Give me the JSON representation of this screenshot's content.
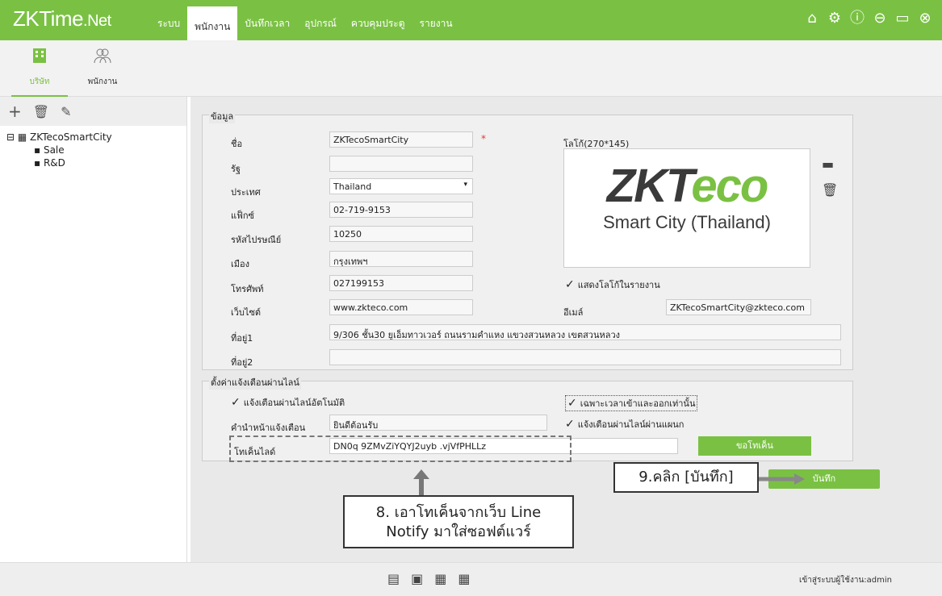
{
  "app": {
    "logo_main": "ZKTime",
    "logo_suffix": ".Net"
  },
  "menu": [
    "ระบบ",
    "พนักงาน",
    "บันทึกเวลา",
    "อุปกรณ์",
    "ควบคุมประตู",
    "รายงาน"
  ],
  "subtabs": [
    "บริษัท",
    "พนักงาน"
  ],
  "tree": {
    "root": "ZKTecoSmartCity",
    "children": [
      "Sale",
      "R&D"
    ]
  },
  "info": {
    "section": "ข้อมูล",
    "name_label": "ชื่อ",
    "name": "ZKTecoSmartCity",
    "required": "*",
    "state_label": "รัฐ",
    "state": "",
    "country_label": "ประเทศ",
    "country": "Thailand",
    "fax_label": "แฟ็กซ์",
    "fax": "02-719-9153",
    "zip_label": "รหัสไปรษณีย์",
    "zip": "10250",
    "city_label": "เมือง",
    "city": "กรุงเทพฯ",
    "phone_label": "โทรศัพท์",
    "phone": "027199153",
    "website_label": "เว็บไซต์",
    "website": "www.zkteco.com",
    "email_label": "อีเมล์",
    "email": "ZKTecoSmartCity@zkteco.com",
    "addr1_label": "ที่อยู่1",
    "addr1": "9/306 ชั้น30 ยูเอ็มทาวเวอร์ ถนนรามคำแหง แขวงสวนหลวง เขตสวนหลวง",
    "addr2_label": "ที่อยู่2",
    "addr2": "",
    "logo_label": "โลโก้(270*145)",
    "logo_text_1": "ZKT",
    "logo_text_2": "eco",
    "logo_sub": "Smart City (Thailand)",
    "show_logo": "แสดงโลโก้ในรายงาน"
  },
  "line": {
    "section": "ตั้งค่าแจ้งเตือนผ่านไลน์",
    "auto": "แจ้งเตือนผ่านไลน์อัตโนมัติ",
    "inout_only": "เฉพาะเวลาเข้าและออกเท่านั้น",
    "prefix_label": "คำนำหน้าแจ้งเตือน",
    "prefix": "ยินดีต้อนรับ",
    "dept": "แจ้งเตือนผ่านไลน์ผ่านแผนก",
    "token_label": "โทเค็นไลด์",
    "token": "DN0q          9ZMvZiYQYJ2uyb             .vjVfPHLLz",
    "get_token": "ขอโทเค็น"
  },
  "save": "บันทึก",
  "callout_8": "8. เอาโทเค็นจากเว็บ Line Notify มาใส่ซอฟต์แวร์",
  "callout_9": "9.คลิก [บันทึก]",
  "footer_status": "เข้าสู่ระบบผู้ใช้งาน:admin",
  "colors": {
    "accent": "#7ac143"
  }
}
